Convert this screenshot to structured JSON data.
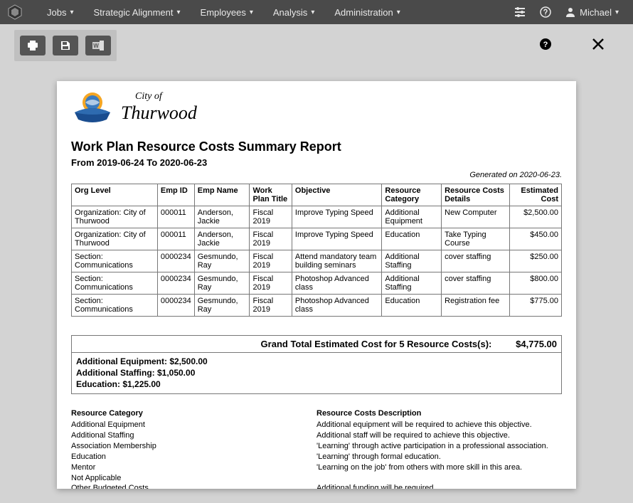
{
  "nav": {
    "items": [
      "Jobs",
      "Strategic Alignment",
      "Employees",
      "Analysis",
      "Administration"
    ],
    "user": "Michael"
  },
  "report": {
    "org_label_prefix": "City of",
    "org_name": "Thurwood",
    "title": "Work Plan Resource Costs Summary Report",
    "range": "From 2019-06-24 To 2020-06-23",
    "generated": "Generated on 2020-06-23.",
    "columns": [
      "Org Level",
      "Emp ID",
      "Emp Name",
      "Work Plan Title",
      "Objective",
      "Resource Category",
      "Resource Costs Details",
      "Estimated Cost"
    ],
    "rows": [
      {
        "org": "Organization: City of Thurwood",
        "emp_id": "000011",
        "emp_name": "Anderson, Jackie",
        "wp": "Fiscal 2019",
        "obj": "Improve Typing Speed",
        "cat": "Additional Equipment",
        "details": "New Computer",
        "cost": "$2,500.00"
      },
      {
        "org": "Organization: City of Thurwood",
        "emp_id": "000011",
        "emp_name": "Anderson, Jackie",
        "wp": "Fiscal 2019",
        "obj": "Improve Typing Speed",
        "cat": "Education",
        "details": "Take Typing Course",
        "cost": "$450.00"
      },
      {
        "org": "Section: Communications",
        "emp_id": "0000234",
        "emp_name": "Gesmundo, Ray",
        "wp": "Fiscal 2019",
        "obj": "Attend mandatory team building seminars",
        "cat": "Additional Staffing",
        "details": "cover staffing",
        "cost": "$250.00"
      },
      {
        "org": "Section: Communications",
        "emp_id": "0000234",
        "emp_name": "Gesmundo, Ray",
        "wp": "Fiscal 2019",
        "obj": "Photoshop Advanced class",
        "cat": "Additional Staffing",
        "details": "cover staffing",
        "cost": "$800.00"
      },
      {
        "org": "Section: Communications",
        "emp_id": "0000234",
        "emp_name": "Gesmundo, Ray",
        "wp": "Fiscal 2019",
        "obj": "Photoshop Advanced class",
        "cat": "Education",
        "details": "Registration fee",
        "cost": "$775.00"
      }
    ],
    "grand_label": "Grand Total Estimated Cost for 5 Resource Costs(s):",
    "grand_total": "$4,775.00",
    "subtotals": [
      "Additional Equipment: $2,500.00",
      "Additional Staffing: $1,050.00",
      "Education: $1,225.00"
    ],
    "legend": {
      "cat_header": "Resource Category",
      "desc_header": "Resource Costs Description",
      "items": [
        {
          "cat": "Additional Equipment",
          "desc": "Additional equipment will be required to achieve this objective."
        },
        {
          "cat": "Additional Staffing",
          "desc": "Additional staff will be required to achieve this objective."
        },
        {
          "cat": "Association Membership",
          "desc": "'Learning' through active participation in a professional association."
        },
        {
          "cat": "Education",
          "desc": "'Learning' through formal education."
        },
        {
          "cat": "Mentor",
          "desc": "'Learning on the job' from others with more skill in this area."
        },
        {
          "cat": "Not Applicable",
          "desc": ""
        },
        {
          "cat": "Other Budgeted Costs",
          "desc": "Additional funding will be required."
        }
      ]
    }
  }
}
